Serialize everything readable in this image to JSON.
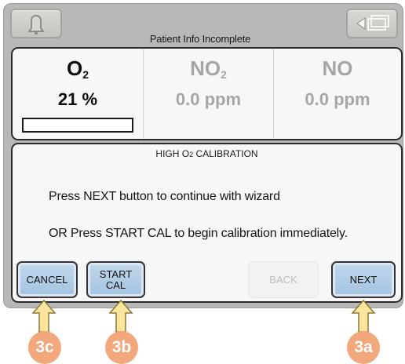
{
  "status_bar": {
    "title": "Patient Info Incomplete",
    "left_icon": "bell-icon",
    "right_icon": "screen-switch-icon"
  },
  "gas_readings": [
    {
      "name": "O",
      "subscript": "2",
      "value": "21 %",
      "state": "active",
      "level": 0.0
    },
    {
      "name": "NO",
      "subscript": "2",
      "value": "0.0 ppm",
      "state": "inactive"
    },
    {
      "name": "NO",
      "subscript": "",
      "value": "0.0 ppm",
      "state": "inactive"
    }
  ],
  "wizard": {
    "title_prefix": "HIGH O",
    "title_sub": "2",
    "title_suffix": " CALIBRATION",
    "line1": "Press NEXT button to continue with wizard",
    "line2": "OR Press START CAL to begin calibration immediately."
  },
  "buttons": {
    "cancel": "CANCEL",
    "start_line1": "START",
    "start_line2": "CAL",
    "back": "BACK",
    "next": "NEXT"
  },
  "annotations": {
    "cancel_badge": "3c",
    "start_badge": "3b",
    "next_badge": "3a"
  },
  "colors": {
    "device_bezel": "#b9b8b6",
    "button_blue": "#a3c3e0",
    "annotation_orange": "#f3a77d",
    "arrow_fill": "#fbe49b"
  }
}
